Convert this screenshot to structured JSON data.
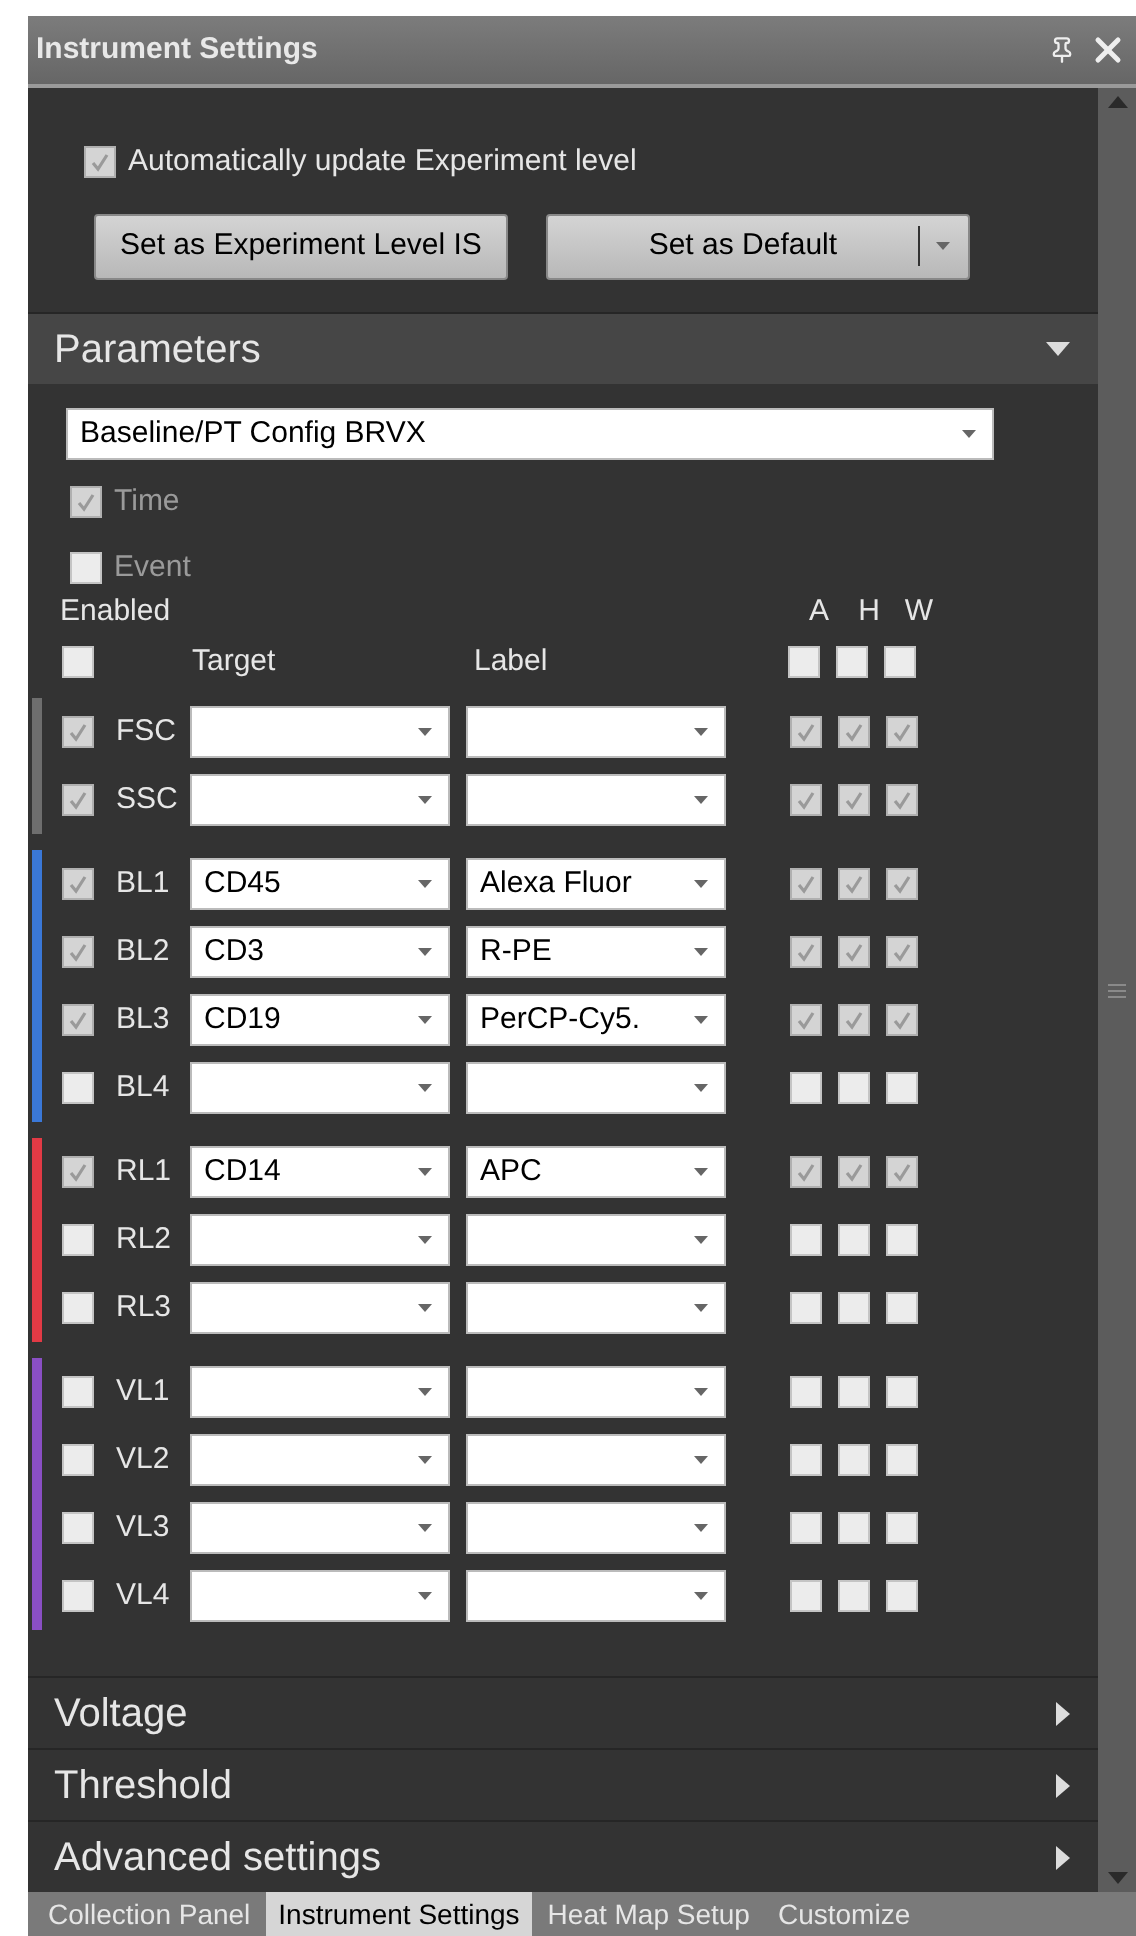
{
  "window": {
    "title": "Instrument Settings"
  },
  "auto_update": {
    "label": "Automatically update Experiment level",
    "checked": true
  },
  "buttons": [
    {
      "label": "Set as Experiment Level IS",
      "kind": "plain"
    },
    {
      "label": "Set as Default",
      "kind": "split"
    }
  ],
  "sections": [
    {
      "title": "Parameters",
      "expanded": true
    },
    {
      "title": "Voltage",
      "expanded": false
    },
    {
      "title": "Threshold",
      "expanded": false
    },
    {
      "title": "Advanced settings",
      "expanded": false
    }
  ],
  "parameters": {
    "config": {
      "value": "Baseline/PT Config BRVX"
    },
    "extras": [
      {
        "label": "Time",
        "checked": true,
        "disabled": true
      },
      {
        "label": "Event",
        "checked": false,
        "disabled": true
      }
    ],
    "enabled_header": "Enabled",
    "all_enabled": {
      "checked": false
    },
    "columns": {
      "target": "Target",
      "label": "Label",
      "a": "A",
      "h": "H",
      "w": "W"
    },
    "all_a": {
      "checked": false
    },
    "all_h": {
      "checked": false
    },
    "all_w": {
      "checked": false
    },
    "groups": [
      {
        "color": "#6e6e6e",
        "channels": [
          {
            "name": "FSC",
            "enabled": true,
            "a": true,
            "h": true,
            "w": true
          },
          {
            "name": "SSC",
            "enabled": true,
            "a": true,
            "h": true,
            "w": true
          }
        ]
      },
      {
        "color": "#3a78d8",
        "channels": [
          {
            "name": "BL1",
            "enabled": true,
            "target": "CD45",
            "label": "Alexa Fluor",
            "a": true,
            "h": true,
            "w": true
          },
          {
            "name": "BL2",
            "enabled": true,
            "target": "CD3",
            "label": "R-PE",
            "a": true,
            "h": true,
            "w": true
          },
          {
            "name": "BL3",
            "enabled": true,
            "target": "CD19",
            "label": "PerCP-Cy5.",
            "a": true,
            "h": true,
            "w": true
          },
          {
            "name": "BL4",
            "enabled": false,
            "a": false,
            "h": false,
            "w": false
          }
        ]
      },
      {
        "color": "#e23a45",
        "channels": [
          {
            "name": "RL1",
            "enabled": true,
            "target": "CD14",
            "label": "APC",
            "a": true,
            "h": true,
            "w": true
          },
          {
            "name": "RL2",
            "enabled": false,
            "a": false,
            "h": false,
            "w": false
          },
          {
            "name": "RL3",
            "enabled": false,
            "a": false,
            "h": false,
            "w": false
          }
        ]
      },
      {
        "color": "#8a4fc4",
        "channels": [
          {
            "name": "VL1",
            "enabled": false,
            "a": false,
            "h": false,
            "w": false
          },
          {
            "name": "VL2",
            "enabled": false,
            "a": false,
            "h": false,
            "w": false
          },
          {
            "name": "VL3",
            "enabled": false,
            "a": false,
            "h": false,
            "w": false
          },
          {
            "name": "VL4",
            "enabled": false,
            "a": false,
            "h": false,
            "w": false
          }
        ]
      }
    ]
  },
  "bottom_tabs": [
    {
      "label": "Collection Panel",
      "selected": false
    },
    {
      "label": "Instrument Settings",
      "selected": true
    },
    {
      "label": "Heat Map Setup",
      "selected": false
    },
    {
      "label": "Customize",
      "selected": false
    }
  ]
}
